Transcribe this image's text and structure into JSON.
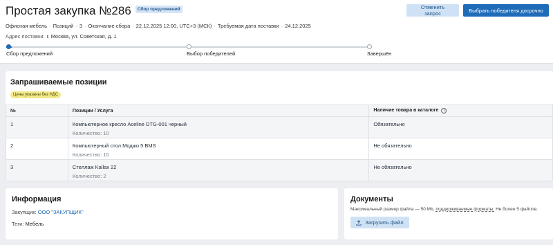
{
  "header": {
    "title": "Простая закупка №286",
    "badge": "Сбор предложений",
    "cancel_label": "Отменить запрос",
    "choose_label": "Выбрать победителя досрочно",
    "category": "Офисная мебель",
    "positions_label": "Позиций",
    "positions_count": "3",
    "collection_end_label": "Окончание сбора",
    "collection_end": "22.12.2025 12:00, UTC+3 (МСК)",
    "delivery_label": "Требуемая дата поставки",
    "delivery_date": "24.12.2025",
    "address_label": "Адрес поставки:",
    "address": "г. Москва, ул. Советская, д. 1"
  },
  "stepper": {
    "steps": [
      "Сбор предложений",
      "Выбор победителей",
      "Завершён"
    ],
    "current_step": 1,
    "progress": 0.015
  },
  "positions": {
    "title": "Запрашиваемые позиции",
    "vat_note": "Цены указаны без НДС",
    "columns": [
      "№",
      "Позиции / Услуга",
      "Наличие товара в каталоге"
    ],
    "rows": [
      {
        "num": "1",
        "name": "Компьютерное кресло Aceline DTG-001 черный",
        "qty": "Количество: 10",
        "catalog": "Обязательно"
      },
      {
        "num": "2",
        "name": "Компьютерный стол Моджо 5 BMS",
        "qty": "Количество: 10",
        "catalog": "Не обязательно"
      },
      {
        "num": "3",
        "name": "Стеллаж Kallax 22",
        "qty": "Количество: 2",
        "catalog": "Не обязательно"
      }
    ]
  },
  "info": {
    "title": "Информация",
    "customer_label": "Закупщик:",
    "customer": "ООО \"ЗАКУПЩИК\"",
    "tags_label": "Теги:",
    "tags": "Мебель"
  },
  "docs": {
    "title": "Документы",
    "hint_prefix": "Максимальный размер файла — 50 Mb,",
    "hint_formats": "поддерживаемые форматы.",
    "hint_suffix": "Не более 5 файлов.",
    "upload_label": "Загрузить файл"
  },
  "colors": {
    "accent": "#1e6bb8",
    "secondary_button": "#cfe2f5",
    "vat_badge": "#f3e98a"
  }
}
